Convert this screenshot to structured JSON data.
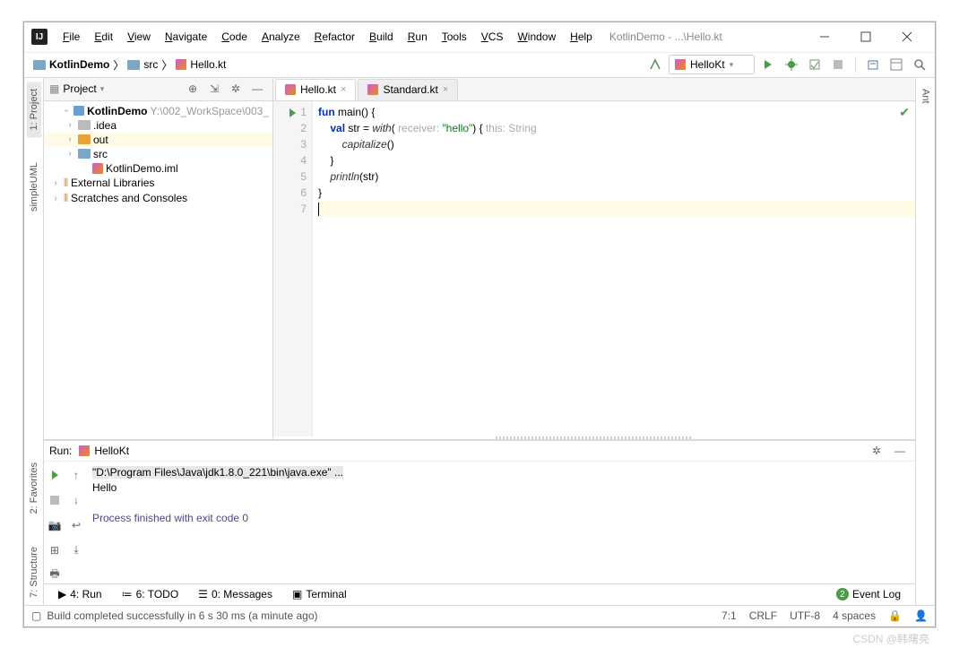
{
  "window_title": "KotlinDemo - ...\\Hello.kt",
  "menu": [
    "File",
    "Edit",
    "View",
    "Navigate",
    "Code",
    "Analyze",
    "Refactor",
    "Build",
    "Run",
    "Tools",
    "VCS",
    "Window",
    "Help"
  ],
  "breadcrumbs": [
    {
      "icon": "folder",
      "label": "KotlinDemo"
    },
    {
      "icon": "folder",
      "label": "src"
    },
    {
      "icon": "kt",
      "label": "Hello.kt"
    }
  ],
  "run_config_label": "HelloKt",
  "left_tabs": [
    "1: Project",
    "simpleUML"
  ],
  "right_tabs": [
    "Ant"
  ],
  "project_panel": {
    "title": "Project",
    "root": {
      "label": "KotlinDemo",
      "path": "Y:\\002_WorkSpace\\003_"
    },
    "children": [
      {
        "label": ".idea",
        "icon": "folder-gray",
        "indent": 1
      },
      {
        "label": "out",
        "icon": "folder-orange",
        "indent": 1,
        "selected": true
      },
      {
        "label": "src",
        "icon": "folder-teal",
        "indent": 1
      },
      {
        "label": "KotlinDemo.iml",
        "icon": "kt",
        "indent": 2,
        "leaf": true
      }
    ],
    "extra": [
      {
        "label": "External Libraries",
        "icon": "lib"
      },
      {
        "label": "Scratches and Consoles",
        "icon": "scratch"
      }
    ]
  },
  "tabs": [
    {
      "label": "Hello.kt",
      "active": true
    },
    {
      "label": "Standard.kt",
      "active": false
    }
  ],
  "code": {
    "lines": [
      {
        "n": 1,
        "html": "<span class='kw'>fun</span> main() {",
        "play": true
      },
      {
        "n": 2,
        "html": "    <span class='kw'>val</span> str = <span class='fn'>with</span>( <span class='hint'>receiver:</span> <span class='str'>\"hello\"</span>) { <span class='hint'>this: String</span>"
      },
      {
        "n": 3,
        "html": "        <span class='fn'>capitalize</span>()"
      },
      {
        "n": 4,
        "html": "    }"
      },
      {
        "n": 5,
        "html": "    <span class='fn'>println</span>(str)"
      },
      {
        "n": 6,
        "html": "}"
      },
      {
        "n": 7,
        "html": "",
        "hl": true
      }
    ]
  },
  "run_panel": {
    "label": "Run:",
    "config": "HelloKt",
    "cmd": "\"D:\\Program Files\\Java\\jdk1.8.0_221\\bin\\java.exe\" ...",
    "output": "Hello",
    "exit": "Process finished with exit code 0"
  },
  "bottom_tabs": [
    "4: Run",
    "6: TODO",
    "0: Messages",
    "Terminal"
  ],
  "event_log": "Event Log",
  "status": {
    "msg": "Build completed successfully in 6 s 30 ms (a minute ago)",
    "pos": "7:1",
    "eol": "CRLF",
    "enc": "UTF-8",
    "indent": "4 spaces"
  },
  "watermark": "CSDN @韩曙亮"
}
